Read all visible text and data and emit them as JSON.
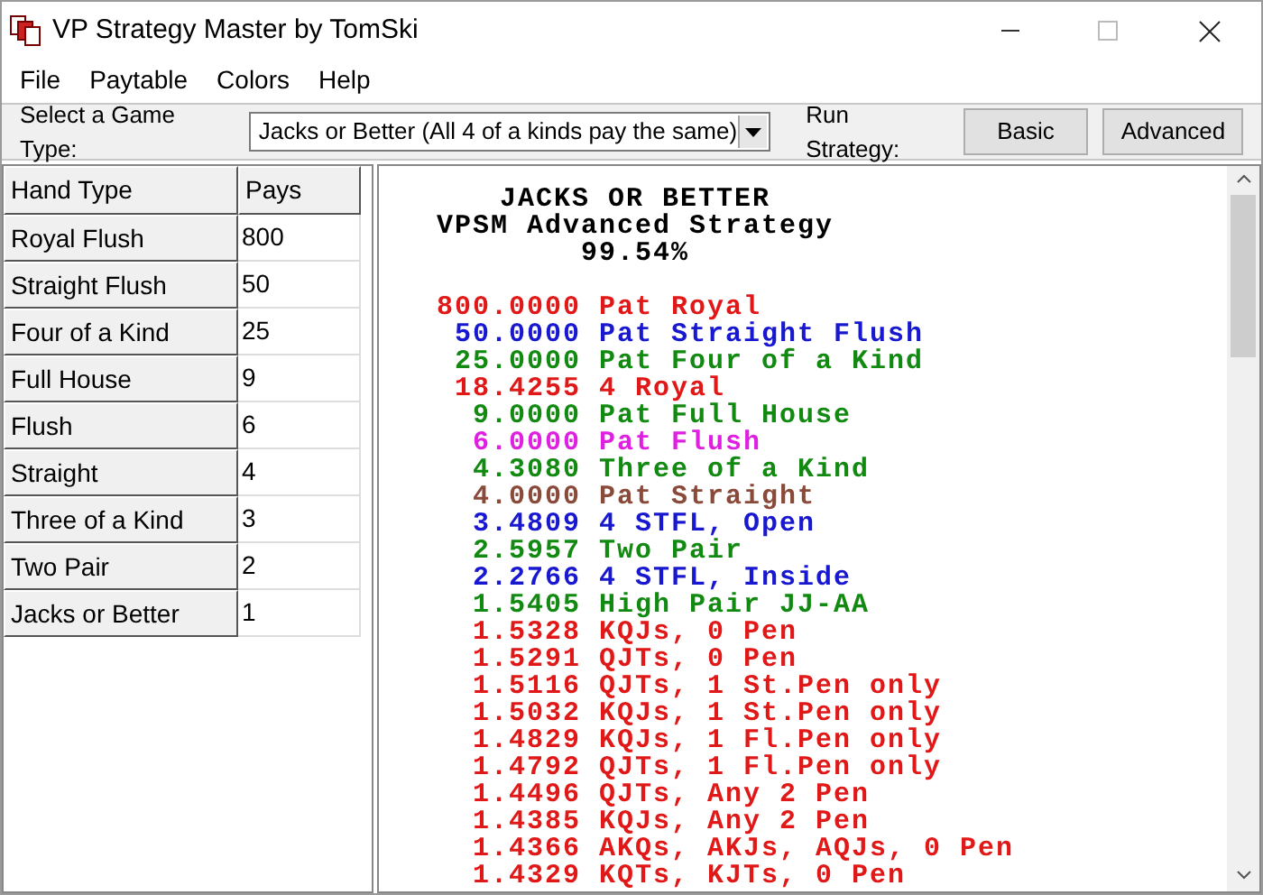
{
  "window": {
    "title": "VP Strategy Master by TomSki"
  },
  "menu": [
    "File",
    "Paytable",
    "Colors",
    "Help"
  ],
  "toolbar": {
    "game_label": "Select a Game Type:",
    "game_value": "Jacks or Better (All 4 of a kinds pay the same)",
    "run_label": "Run Strategy:",
    "buttons": [
      "Basic",
      "Advanced"
    ]
  },
  "paytable": {
    "columns": [
      "Hand Type",
      "Pays"
    ],
    "rows": [
      {
        "hand": "Royal Flush",
        "pays": "800"
      },
      {
        "hand": "Straight Flush",
        "pays": "50"
      },
      {
        "hand": "Four of a Kind",
        "pays": "25"
      },
      {
        "hand": "Full House",
        "pays": "9"
      },
      {
        "hand": "Flush",
        "pays": "6"
      },
      {
        "hand": "Straight",
        "pays": "4"
      },
      {
        "hand": "Three of a Kind",
        "pays": "3"
      },
      {
        "hand": "Two Pair",
        "pays": "2"
      },
      {
        "hand": "Jacks or Better",
        "pays": "1"
      }
    ]
  },
  "strategy": {
    "heading": [
      "JACKS OR BETTER",
      "VPSM Advanced Strategy",
      "99.54%"
    ],
    "lines": [
      {
        "value": "800.0000",
        "text": "Pat Royal",
        "color": "#e01818"
      },
      {
        "value": "50.0000",
        "text": "Pat Straight Flush",
        "color": "#1818d0"
      },
      {
        "value": "25.0000",
        "text": "Pat Four of a Kind",
        "color": "#128a12"
      },
      {
        "value": "18.4255",
        "text": "4 Royal",
        "color": "#e01818"
      },
      {
        "value": "9.0000",
        "text": "Pat Full House",
        "color": "#128a12"
      },
      {
        "value": "6.0000",
        "text": "Pat Flush",
        "color": "#e020e0"
      },
      {
        "value": "4.3080",
        "text": "Three of a Kind",
        "color": "#128a12"
      },
      {
        "value": "4.0000",
        "text": "Pat Straight",
        "color": "#8a4a3a"
      },
      {
        "value": "3.4809",
        "text": "4 STFL, Open",
        "color": "#1818d0"
      },
      {
        "value": "2.5957",
        "text": "Two Pair",
        "color": "#128a12"
      },
      {
        "value": "2.2766",
        "text": "4 STFL, Inside",
        "color": "#1818d0"
      },
      {
        "value": "1.5405",
        "text": "High Pair JJ-AA",
        "color": "#128a12"
      },
      {
        "value": "1.5328",
        "text": "KQJs, 0 Pen",
        "color": "#e01818"
      },
      {
        "value": "1.5291",
        "text": "QJTs, 0 Pen",
        "color": "#e01818"
      },
      {
        "value": "1.5116",
        "text": "QJTs, 1 St.Pen only",
        "color": "#e01818"
      },
      {
        "value": "1.5032",
        "text": "KQJs, 1 St.Pen only",
        "color": "#e01818"
      },
      {
        "value": "1.4829",
        "text": "KQJs, 1 Fl.Pen only",
        "color": "#e01818"
      },
      {
        "value": "1.4792",
        "text": "QJTs, 1 Fl.Pen only",
        "color": "#e01818"
      },
      {
        "value": "1.4496",
        "text": "QJTs, Any 2 Pen",
        "color": "#e01818"
      },
      {
        "value": "1.4385",
        "text": "KQJs, Any 2 Pen",
        "color": "#e01818"
      },
      {
        "value": "1.4366",
        "text": "AKQs, AKJs, AQJs, 0 Pen",
        "color": "#e01818"
      },
      {
        "value": "1.4329",
        "text": "KQTs, KJTs, 0 Pen",
        "color": "#e01818"
      }
    ]
  }
}
